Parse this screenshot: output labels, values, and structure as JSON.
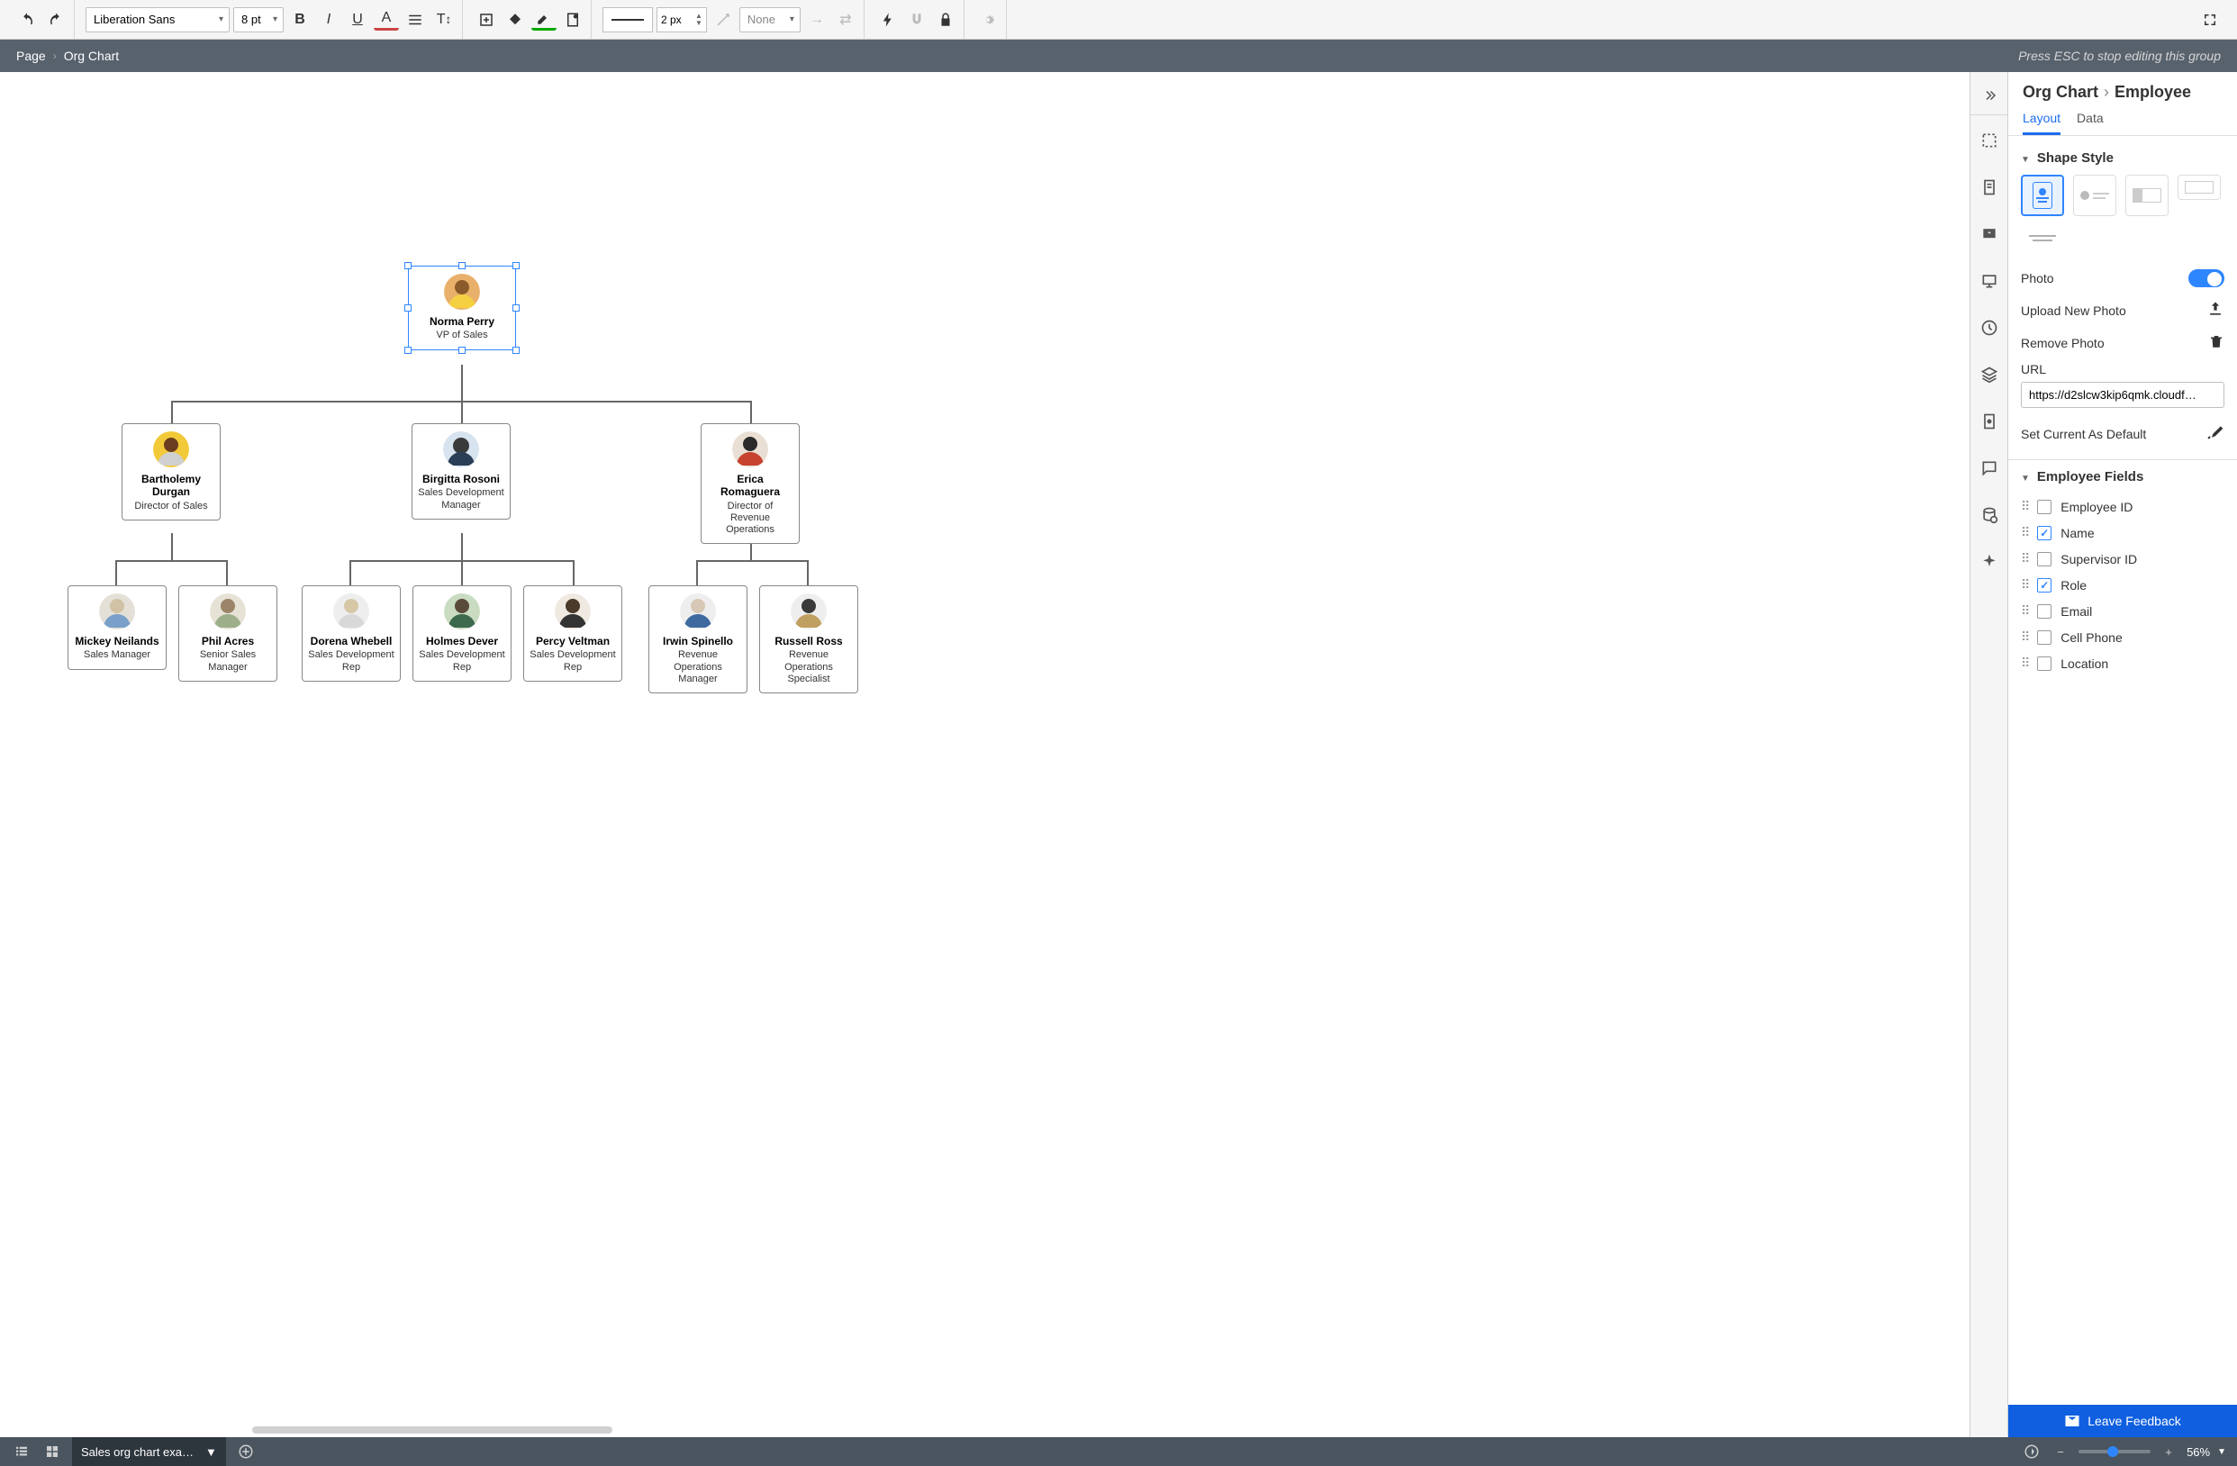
{
  "toolbar": {
    "font": "Liberation Sans",
    "size": "8 pt",
    "stroke": "2 px",
    "arrow_select": "None"
  },
  "breadcrumb": {
    "page": "Page",
    "current": "Org Chart",
    "hint": "Press ESC to stop editing this group"
  },
  "chart": {
    "root": {
      "name": "Norma Perry",
      "role": "VP of Sales"
    },
    "managers": [
      {
        "name": "Bartholemy Durgan",
        "role": "Director of Sales"
      },
      {
        "name": "Birgitta Rosoni",
        "role": "Sales Development Manager"
      },
      {
        "name": "Erica Romaguera",
        "role": "Director of Revenue Operations"
      }
    ],
    "reports": [
      {
        "name": "Mickey Neilands",
        "role": "Sales Manager"
      },
      {
        "name": "Phil Acres",
        "role": "Senior Sales Manager"
      },
      {
        "name": "Dorena Whebell",
        "role": "Sales Development Rep"
      },
      {
        "name": "Holmes Dever",
        "role": "Sales Development Rep"
      },
      {
        "name": "Percy Veltman",
        "role": "Sales Development Rep"
      },
      {
        "name": "Irwin Spinello",
        "role": "Revenue Operations Manager"
      },
      {
        "name": "Russell Ross",
        "role": "Revenue Operations Specialist"
      }
    ]
  },
  "panel": {
    "crumb_root": "Org Chart",
    "crumb_leaf": "Employee",
    "tabs": {
      "layout": "Layout",
      "data": "Data"
    },
    "sections": {
      "shape_style": "Shape Style",
      "photo": "Photo",
      "upload": "Upload New Photo",
      "remove": "Remove Photo",
      "url_label": "URL",
      "url_value": "https://d2slcw3kip6qmk.cloudf…",
      "set_default": "Set Current As Default",
      "employee_fields": "Employee Fields"
    },
    "fields": [
      {
        "label": "Employee ID",
        "checked": false
      },
      {
        "label": "Name",
        "checked": true
      },
      {
        "label": "Supervisor ID",
        "checked": false
      },
      {
        "label": "Role",
        "checked": true
      },
      {
        "label": "Email",
        "checked": false
      },
      {
        "label": "Cell Phone",
        "checked": false
      },
      {
        "label": "Location",
        "checked": false
      }
    ]
  },
  "bottom": {
    "page_name": "Sales org chart exam…",
    "zoom": "56%",
    "feedback": "Leave Feedback"
  }
}
